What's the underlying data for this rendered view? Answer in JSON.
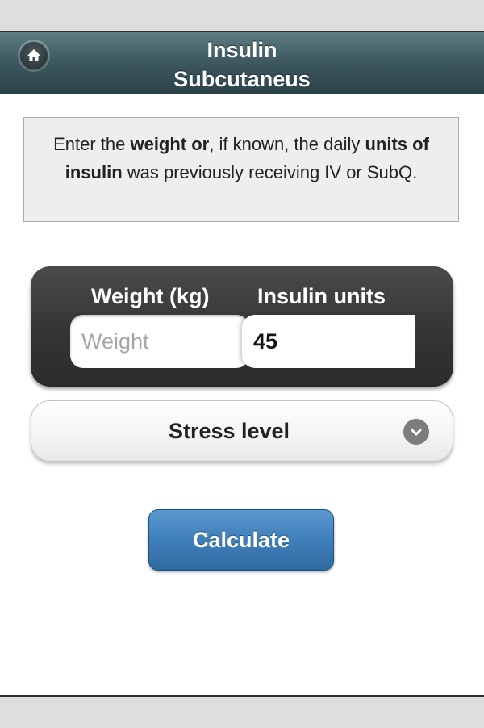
{
  "header": {
    "title_line1": "Insulin",
    "title_line2": "Subcutaneus",
    "home_icon": "home-icon"
  },
  "info": {
    "part1": "Enter the ",
    "bold1": "weight or",
    "part2": ", if known, the daily ",
    "bold2": "units of insulin",
    "part3": " was previously receiving IV or SubQ."
  },
  "inputs": {
    "weight_label": "Weight (kg)",
    "weight_placeholder": "Weight",
    "weight_value": "",
    "insulin_label": "Insulin units",
    "insulin_value": "45"
  },
  "stress": {
    "label": "Stress level",
    "arrow_icon": "chevron-down-icon"
  },
  "calculate": {
    "label": "Calculate"
  },
  "colors": {
    "header": "#3f5a61",
    "panel": "#363636",
    "button": "#3f7fb8"
  }
}
